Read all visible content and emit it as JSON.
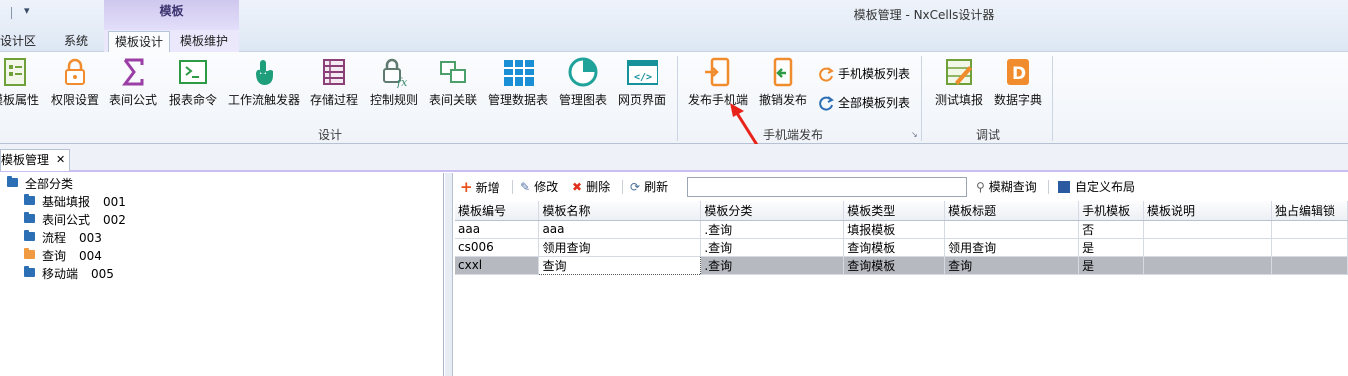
{
  "window": {
    "title": "模板管理 - NxCells设计器",
    "context_tab_header": "模板"
  },
  "ribbon_tabs": [
    "设计区",
    "系统",
    "模板设计",
    "模板维护"
  ],
  "ribbon": {
    "design_group": {
      "label": "设计",
      "buttons": [
        "模板属性",
        "权限设置",
        "表间公式",
        "报表命令",
        "工作流触发器",
        "存储过程",
        "控制规则",
        "表间关联",
        "管理数据表",
        "管理图表",
        "网页界面"
      ]
    },
    "mobile_group": {
      "label": "手机端发布",
      "buttons": [
        "发布手机端",
        "撤销发布"
      ],
      "small_buttons": [
        "手机模板列表",
        "全部模板列表"
      ]
    },
    "debug_group": {
      "label": "调试",
      "buttons": [
        "测试填报",
        "数据字典"
      ]
    }
  },
  "doc_tab": {
    "label": "模板管理",
    "close": "✕"
  },
  "tree": {
    "root": "全部分类",
    "children": [
      {
        "label": "基础填报",
        "code": "001"
      },
      {
        "label": "表间公式",
        "code": "002"
      },
      {
        "label": "流程",
        "code": "003"
      },
      {
        "label": "查询",
        "code": "004"
      },
      {
        "label": "移动端",
        "code": "005"
      }
    ]
  },
  "toolbar": {
    "add": "新增",
    "edit": "修改",
    "delete": "删除",
    "refresh": "刷新",
    "search_value": "",
    "fuzzy": "模糊查询",
    "layout": "自定义布局"
  },
  "grid": {
    "columns": [
      "模板编号",
      "模板名称",
      "模板分类",
      "模板类型",
      "模板标题",
      "手机模板",
      "模板说明",
      "独占编辑锁"
    ],
    "rows": [
      [
        "aaa",
        "aaa",
        ".查询",
        "填报模板",
        "",
        "否",
        "",
        ""
      ],
      [
        "cs006",
        "领用查询",
        ".查询",
        "查询模板",
        "领用查询",
        "是",
        "",
        ""
      ],
      [
        "cxxl",
        "查询",
        ".查询",
        "查询模板",
        "查询",
        "是",
        "",
        ""
      ]
    ],
    "selected_row": 2
  },
  "annotation": {
    "color": "#e8231a"
  }
}
